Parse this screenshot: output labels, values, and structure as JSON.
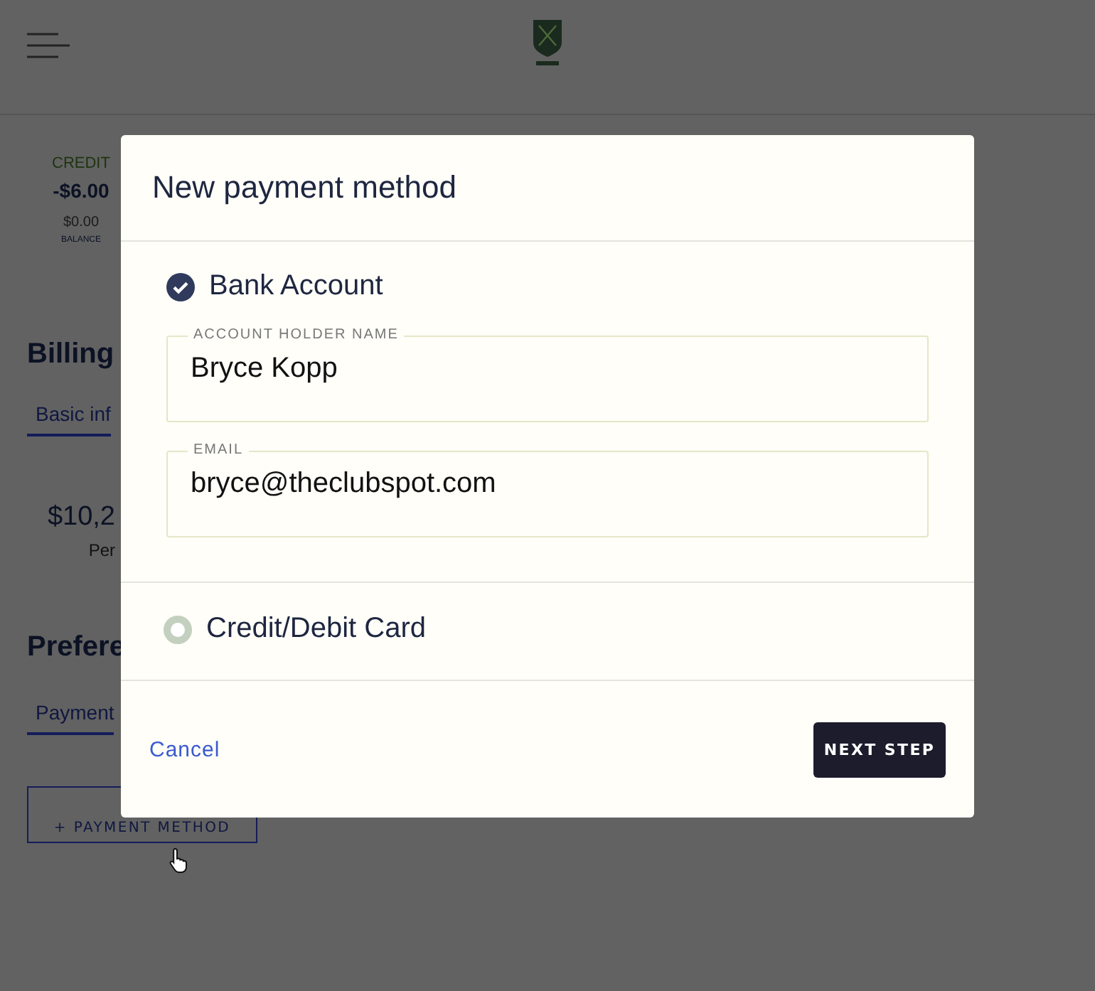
{
  "page": {
    "summary": {
      "label": "CREDIT",
      "amount": "-$6.00",
      "balance": "$0.00",
      "balance_label": "BALANCE"
    },
    "billing": {
      "title": "Billing",
      "tab": "Basic inf",
      "amount": "$10,2",
      "caption": "Per"
    },
    "preferences": {
      "title": "Prefere",
      "tab": "Payment",
      "button": "+ PAYMENT METHOD"
    }
  },
  "dialog": {
    "title": "New payment method",
    "options": [
      {
        "label": "Bank Account",
        "selected": true,
        "fields": [
          {
            "label": "ACCOUNT HOLDER NAME",
            "value": "Bryce Kopp"
          },
          {
            "label": "EMAIL",
            "value": "bryce@theclubspot.com"
          }
        ]
      },
      {
        "label": "Credit/Debit Card",
        "selected": false
      }
    ],
    "cancel": "Cancel",
    "next": "NEXT STEP"
  }
}
